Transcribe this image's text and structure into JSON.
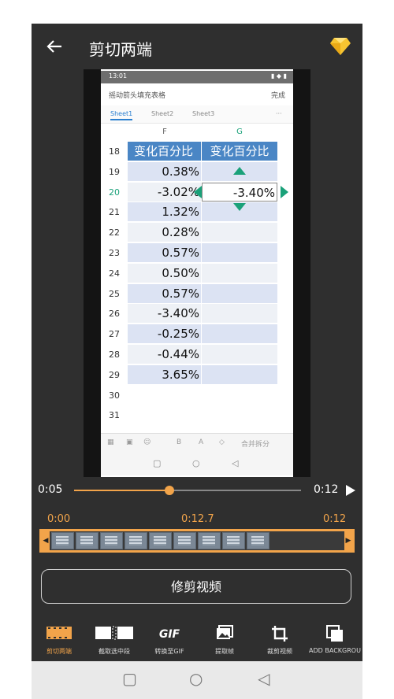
{
  "header": {
    "title": "剪切两端"
  },
  "phone": {
    "status_time": "13:01",
    "doc_title": "摇动箭头填充表格",
    "done_label": "完成",
    "sheets": [
      "Sheet1",
      "Sheet2",
      "Sheet3"
    ],
    "sheets_more": "···",
    "col_f": "F",
    "col_g": "G",
    "rows": [
      {
        "n": "18",
        "f": "变化百分比",
        "g": "变化百分比"
      },
      {
        "n": "19",
        "f": "0.38%",
        "g": ""
      },
      {
        "n": "20",
        "f": "-3.02%",
        "g": "-3.40%"
      },
      {
        "n": "21",
        "f": "1.32%",
        "g": ""
      },
      {
        "n": "22",
        "f": "0.28%",
        "g": ""
      },
      {
        "n": "23",
        "f": "0.57%",
        "g": ""
      },
      {
        "n": "24",
        "f": "0.50%",
        "g": ""
      },
      {
        "n": "25",
        "f": "0.57%",
        "g": ""
      },
      {
        "n": "26",
        "f": "-3.40%",
        "g": ""
      },
      {
        "n": "27",
        "f": "-0.25%",
        "g": ""
      },
      {
        "n": "28",
        "f": "-0.44%",
        "g": ""
      },
      {
        "n": "29",
        "f": "3.65%",
        "g": ""
      },
      {
        "n": "30",
        "f": "",
        "g": ""
      },
      {
        "n": "31",
        "f": "",
        "g": ""
      }
    ],
    "toolbar": {
      "b": "B",
      "a": "A",
      "merge": "合并拆分"
    }
  },
  "player": {
    "current": "0:05",
    "duration": "0:12",
    "progress": 0.42
  },
  "trim": {
    "start": "0:00",
    "mid": "0:12.7",
    "end": "0:12"
  },
  "action_button": "修剪视频",
  "tools": [
    {
      "label": "剪切两端",
      "icon": "film-trim-icon",
      "active": true
    },
    {
      "label": "截取选中段",
      "icon": "film-split-icon",
      "active": false
    },
    {
      "label": "转换至GIF",
      "icon": "gif-icon",
      "active": false
    },
    {
      "label": "提取帧",
      "icon": "image-icon",
      "active": false
    },
    {
      "label": "裁剪视频",
      "icon": "crop-icon",
      "active": false
    },
    {
      "label": "ADD BACKGROU",
      "icon": "background-icon",
      "active": false
    }
  ],
  "colors": {
    "accent": "#f2a44a",
    "bg": "#2f2f2f",
    "cell_blue": "#4a86c5",
    "band": "#dce3f3",
    "teal": "#1aa179"
  }
}
